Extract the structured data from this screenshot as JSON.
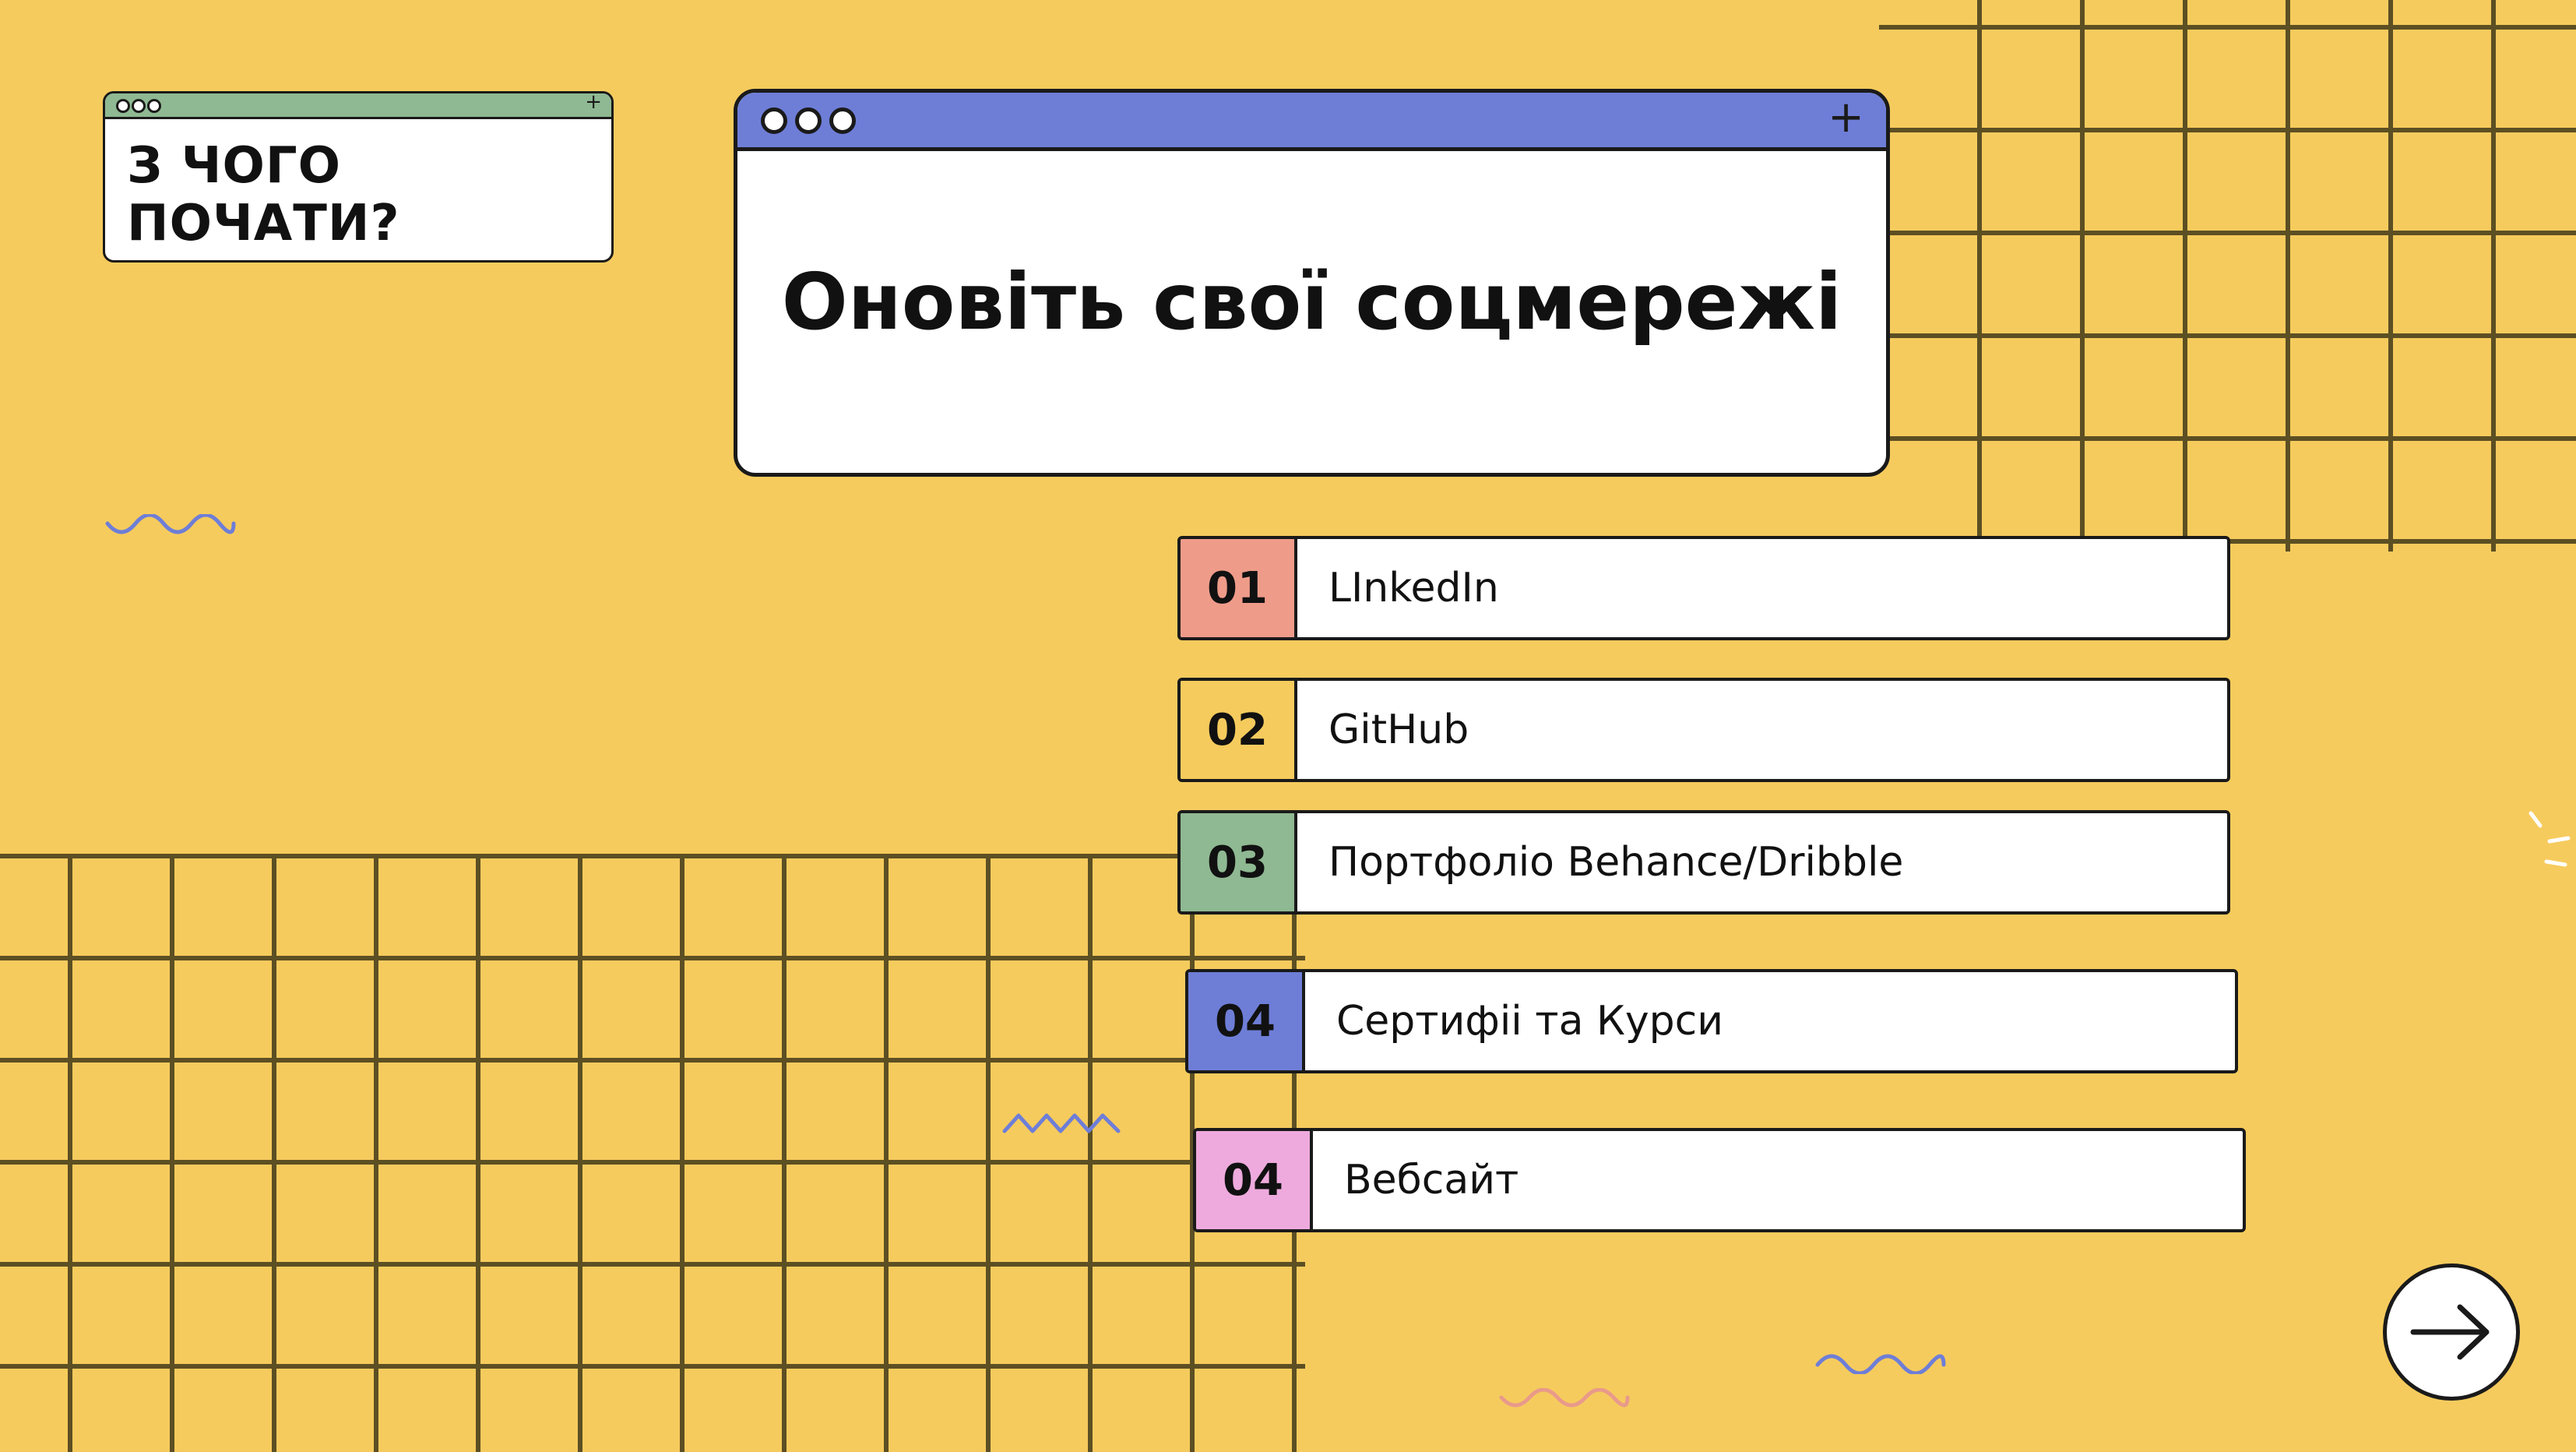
{
  "small_window": {
    "title": "З ЧОГО ПОЧАТИ?",
    "plus_icon": "+"
  },
  "main_window": {
    "title": "Оновіть свої соцмережі",
    "plus_icon": "+"
  },
  "list": [
    {
      "number": "01",
      "label": "LInkedIn",
      "color": "#ef9b8a"
    },
    {
      "number": "02",
      "label": "GitHub",
      "color": "#f6cb5d"
    },
    {
      "number": "03",
      "label": "Портфоліо Behance/Dribble",
      "color": "#8fb992"
    },
    {
      "number": "04",
      "label": "Сертифіі та Курси",
      "color": "#6e7ed7"
    },
    {
      "number": "04",
      "label": "Вебсайт",
      "color": "#eeaadd"
    }
  ],
  "colors": {
    "background": "#f6cb5d",
    "grid": "#5c4f23",
    "accent_blue": "#6e7ed7",
    "accent_green": "#8fb992",
    "accent_pink": "#eeaadd"
  },
  "icons": {
    "next": "arrow-right-icon"
  }
}
